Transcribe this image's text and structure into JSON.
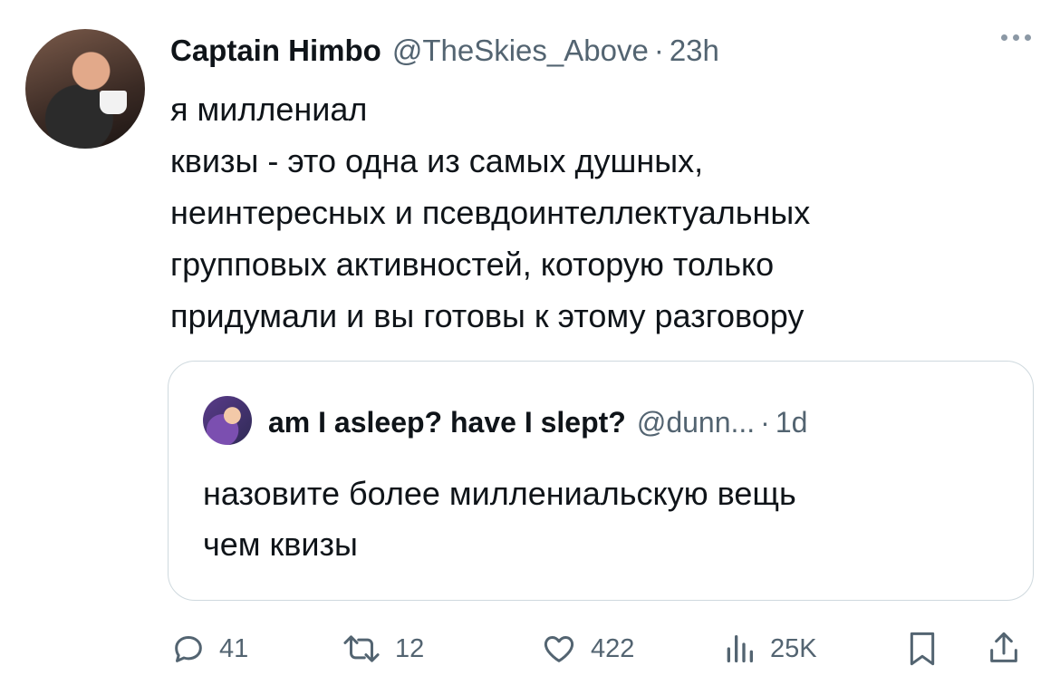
{
  "tweet": {
    "author_name": "Captain Himbo",
    "author_handle": "@TheSkies_Above",
    "separator": "·",
    "time": "23h",
    "text_lines": [
      "я миллениал",
      "квизы - это одна из самых душных,",
      "неинтересных и псевдоинтеллектуальных",
      "групповых активностей, которую только",
      "придумали и вы готовы к этому разговору"
    ]
  },
  "quoted_tweet": {
    "author_name": "am I asleep? have I slept?",
    "author_handle": "@dunn...",
    "separator": "·",
    "time": "1d",
    "text_lines": [
      "назовите более миллениальскую вещь",
      "чем квизы"
    ]
  },
  "actions": {
    "replies": "41",
    "retweets": "12",
    "likes": "422",
    "views": "25K"
  },
  "icons": {
    "more": "more-dots-icon",
    "reply": "reply-bubble-icon",
    "retweet": "retweet-icon",
    "like": "heart-icon",
    "views": "bar-chart-icon",
    "bookmark": "bookmark-icon",
    "share": "share-upload-icon"
  },
  "colors": {
    "text": "#0f1419",
    "secondary": "#536471",
    "border": "#cfd9de"
  }
}
